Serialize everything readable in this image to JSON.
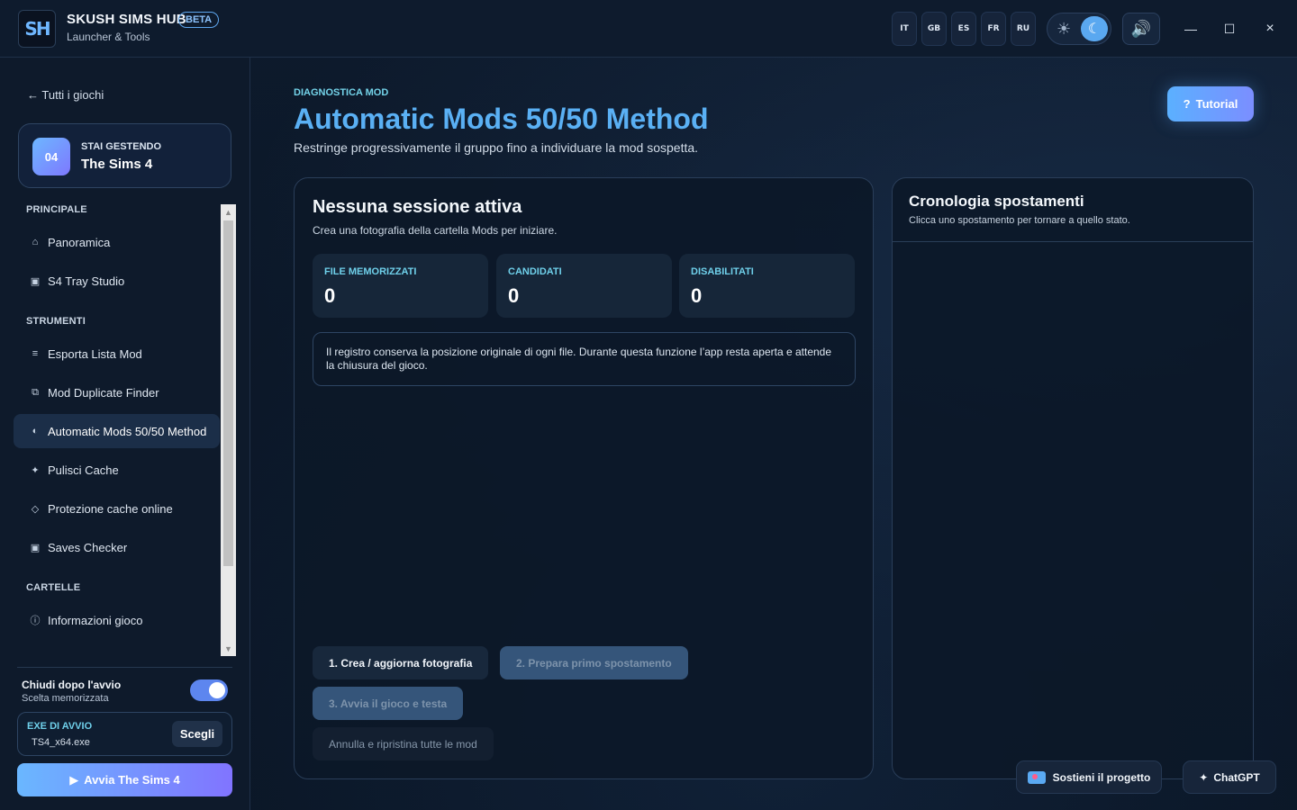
{
  "app": {
    "logo": "SH",
    "title": "SKUSH SIMS HUB",
    "badge": "BETA",
    "subtitle": "Launcher & Tools"
  },
  "languages": [
    "IT",
    "GB",
    "ES",
    "FR",
    "RU"
  ],
  "window_controls": {
    "minimize": "—",
    "maximize": "☐",
    "close": "×"
  },
  "icons": {
    "sun": "☀",
    "moon": "☾",
    "sound": "🔊",
    "back": "←",
    "play": "▶",
    "question": "?",
    "sparkle": "✦"
  },
  "sidebar": {
    "back_label": "Tutti i giochi",
    "game": {
      "number": "04",
      "label": "STAI GESTENDO",
      "name": "The Sims 4"
    },
    "sections": [
      {
        "title": "PRINCIPALE",
        "items": [
          {
            "icon": "⌂",
            "label": "Panoramica"
          },
          {
            "icon": "▣",
            "label": "S4 Tray Studio"
          }
        ]
      },
      {
        "title": "STRUMENTI",
        "items": [
          {
            "icon": "≡",
            "label": "Esporta Lista Mod"
          },
          {
            "icon": "⧉",
            "label": "Mod Duplicate Finder"
          },
          {
            "icon": "◐",
            "label": "Automatic Mods 50/50 Method",
            "active": true
          },
          {
            "icon": "✦",
            "label": "Pulisci Cache"
          },
          {
            "icon": "◇",
            "label": "Protezione cache online"
          },
          {
            "icon": "▣",
            "label": "Saves Checker"
          }
        ]
      },
      {
        "title": "CARTELLE",
        "items": [
          {
            "icon": "ⓘ",
            "label": "Informazioni gioco"
          }
        ]
      }
    ],
    "close_after": {
      "title": "Chiudi dopo l'avvio",
      "subtitle": "Scelta memorizzata",
      "enabled": true
    },
    "exe": {
      "label": "EXE DI AVVIO",
      "value": "TS4_x64.exe",
      "button": "Scegli"
    },
    "launch_label": "Avvia The Sims 4"
  },
  "main": {
    "kicker": "DIAGNOSTICA MOD",
    "title": "Automatic Mods 50/50 Method",
    "subtitle": "Restringe progressivamente il gruppo fino a individuare la mod sospetta.",
    "tutorial_label": "Tutorial",
    "session": {
      "title": "Nessuna sessione attiva",
      "subtitle": "Crea una fotografia della cartella Mods per iniziare.",
      "stats": [
        {
          "label": "FILE MEMORIZZATI",
          "value": "0"
        },
        {
          "label": "CANDIDATI",
          "value": "0"
        },
        {
          "label": "DISABILITATI",
          "value": "0"
        }
      ],
      "notice": "Il registro conserva la posizione originale di ogni file. Durante questa funzione l’app resta aperta e attende la chiusura del gioco.",
      "step1": "1. Crea / aggiorna fotografia",
      "step2": "2. Prepara primo spostamento",
      "step3": "3. Avvia il gioco e testa",
      "cancel": "Annulla e ripristina tutte le mod"
    },
    "history": {
      "title": "Cronologia spostamenti",
      "subtitle": "Clicca uno spostamento per tornare a quello stato."
    }
  },
  "footer": {
    "support_label": "Sostieni il progetto",
    "chatgpt_label": "ChatGPT"
  }
}
